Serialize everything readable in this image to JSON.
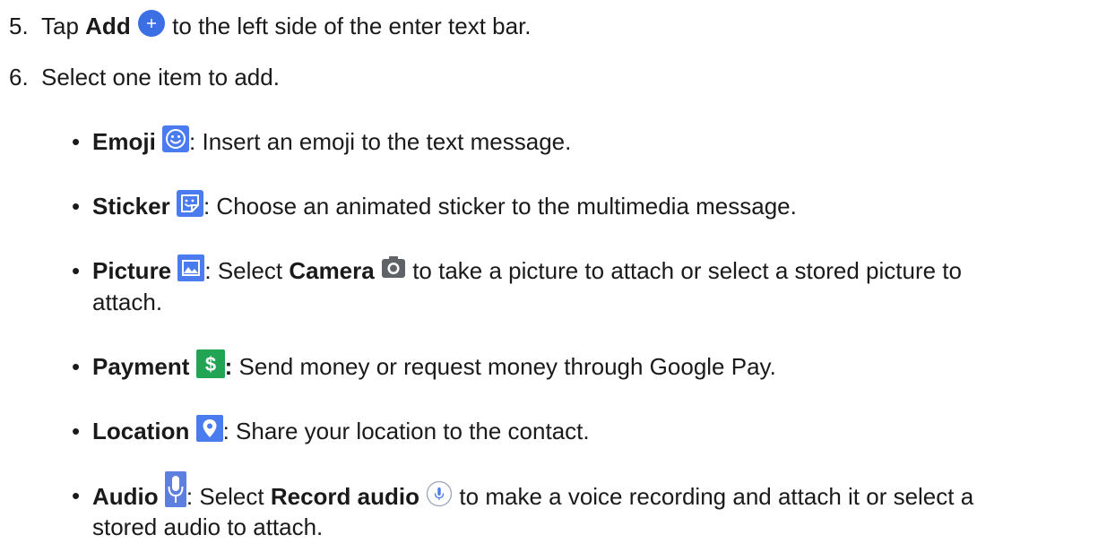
{
  "steps": [
    {
      "number": "5.",
      "pre": "Tap ",
      "bold": "Add",
      "icon": "add-icon",
      "post": " to the left side of the enter text bar."
    },
    {
      "number": "6.",
      "text": "Select one item to add."
    }
  ],
  "bullet_char": "•",
  "items": {
    "emoji": {
      "label": "Emoji",
      "icon": "emoji-icon",
      "text": ": Insert an emoji to the text message."
    },
    "sticker": {
      "label": "Sticker",
      "icon": "sticker-icon",
      "text": ": Choose an animated sticker to the multimedia message."
    },
    "picture": {
      "label": "Picture",
      "icon": "picture-icon",
      "text_a": ": Select ",
      "bold_b": "Camera",
      "icon_b": "camera-icon",
      "text_c": " to take a picture to attach or select a stored picture to",
      "text_d": "attach."
    },
    "payment": {
      "label": "Payment",
      "icon": "payment-icon",
      "colon": ":",
      "text": " Send money or request money through Google Pay."
    },
    "location": {
      "label": "Location",
      "icon": "location-icon",
      "text": ": Share your location to the contact."
    },
    "audio": {
      "label": "Audio",
      "icon": "microphone-icon",
      "text_a": ": Select ",
      "bold_b": "Record audio",
      "icon_b": "record-audio-icon",
      "text_c": " to make a voice recording and attach it or select a",
      "text_d": "stored audio to attach."
    }
  },
  "colors": {
    "text": "#1a1a1a",
    "add_blue": "#3b6fe3",
    "icon_blue": "#4a7cf0",
    "payment_green": "#23a455",
    "camera_gray": "#5f6368",
    "mic_blue": "#5c7fe0"
  }
}
